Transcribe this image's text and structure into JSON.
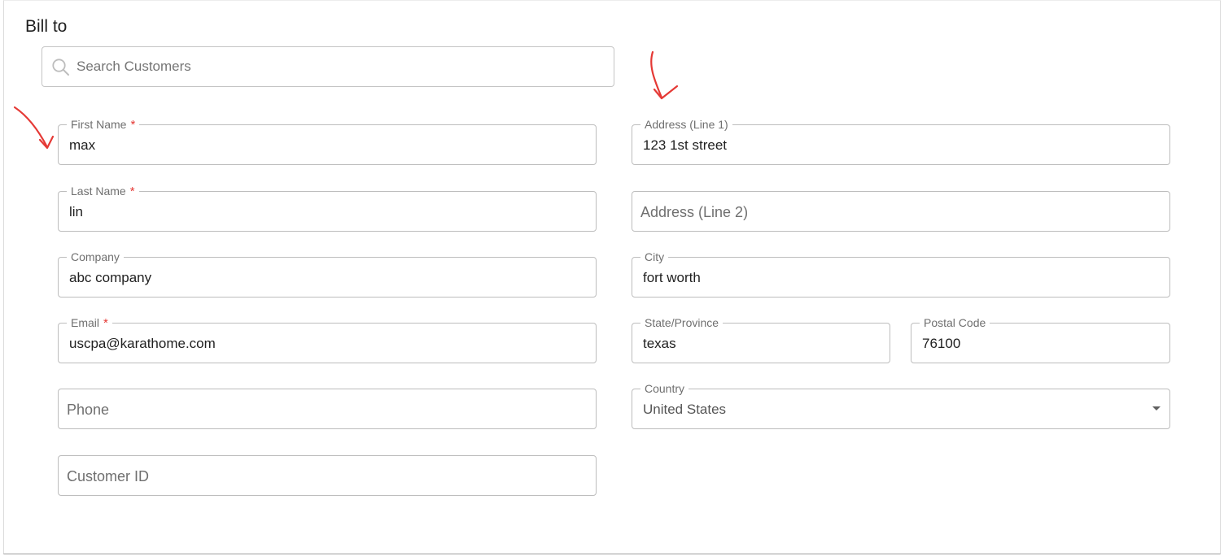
{
  "section": {
    "title": "Bill to"
  },
  "search": {
    "placeholder": "Search Customers"
  },
  "left": {
    "first_name": {
      "label": "First Name",
      "required_mark": "*",
      "value": "max"
    },
    "last_name": {
      "label": "Last Name",
      "required_mark": "*",
      "value": "lin"
    },
    "company": {
      "label": "Company",
      "value": "abc company"
    },
    "email": {
      "label": "Email",
      "required_mark": "*",
      "value": "uscpa@karathome.com"
    },
    "phone": {
      "placeholder": "Phone"
    },
    "customer_id": {
      "placeholder": "Customer ID"
    }
  },
  "right": {
    "address1": {
      "label": "Address (Line 1)",
      "value": "123 1st street"
    },
    "address2": {
      "placeholder": "Address (Line 2)"
    },
    "city": {
      "label": "City",
      "value": "fort worth"
    },
    "state": {
      "label": "State/Province",
      "value": "texas"
    },
    "postal": {
      "label": "Postal Code",
      "value": "76100"
    },
    "country": {
      "label": "Country",
      "value": "United States"
    }
  },
  "icons": {
    "search": "search-icon",
    "dropdown": "chevron-down-icon",
    "annotation": "red-arrow-annotation"
  },
  "colors": {
    "required": "#e53935",
    "annotation": "#e53935",
    "border": "#bdbdbd"
  }
}
